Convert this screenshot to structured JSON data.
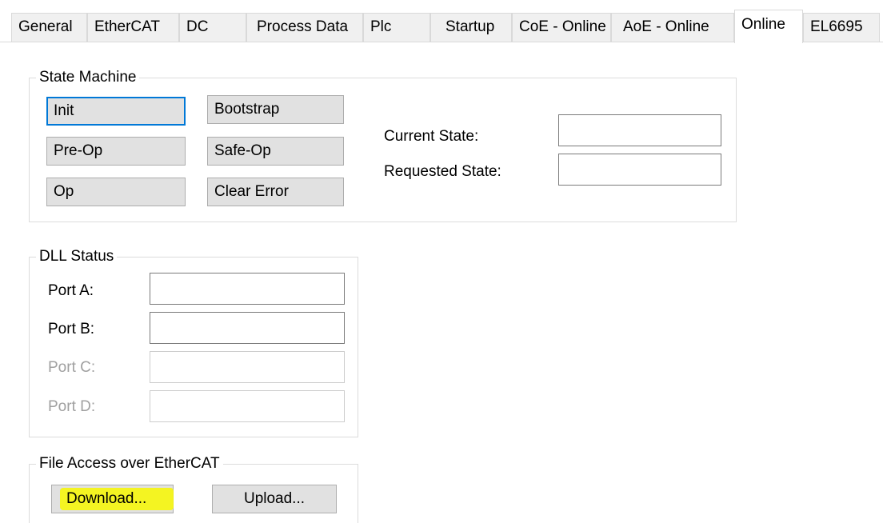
{
  "tabs": [
    {
      "label": "General"
    },
    {
      "label": "EtherCAT"
    },
    {
      "label": "DC"
    },
    {
      "label": "Process Data"
    },
    {
      "label": "Plc"
    },
    {
      "label": "Startup"
    },
    {
      "label": "CoE - Online"
    },
    {
      "label": "AoE - Online"
    },
    {
      "label": "Online",
      "active": true
    },
    {
      "label": "EL6695"
    }
  ],
  "state_machine": {
    "title": "State Machine",
    "buttons": {
      "init": "Init",
      "bootstrap": "Bootstrap",
      "preop": "Pre-Op",
      "safeop": "Safe-Op",
      "op": "Op",
      "clear_error": "Clear Error"
    },
    "current_state_label": "Current State:",
    "current_state_value": "",
    "requested_state_label": "Requested State:",
    "requested_state_value": ""
  },
  "dll_status": {
    "title": "DLL Status",
    "ports": [
      {
        "label": "Port A:",
        "value": "",
        "enabled": true
      },
      {
        "label": "Port B:",
        "value": "",
        "enabled": true
      },
      {
        "label": "Port C:",
        "value": "",
        "enabled": false
      },
      {
        "label": "Port D:",
        "value": "",
        "enabled": false
      }
    ]
  },
  "file_access": {
    "title": "File Access over EtherCAT",
    "download_label": "Download...",
    "upload_label": "Upload..."
  },
  "colors": {
    "focus_border": "#0078d7",
    "highlight": "#f7f700",
    "button_face": "#e1e1e1",
    "disabled_text": "#a0a0a0"
  }
}
